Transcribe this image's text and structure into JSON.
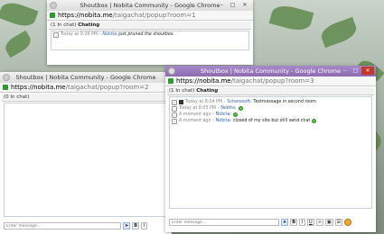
{
  "windows": {
    "back": {
      "title": "Shoutbox | Nobita Community - Google Chrome",
      "url_host": "https://nobita.me",
      "url_path": "/taigachat/popup?room=1",
      "chat_count": "(1 In chat)",
      "chat_status": "Chating",
      "messages": [
        {
          "time": "Today at 9:26 PM -",
          "user": "Nobita",
          "text": "just pruned the shoutbox."
        }
      ]
    },
    "middle": {
      "title": "Shoutbox | Nobita Community - Google Chrome",
      "url_host": "https://nobita.me",
      "url_path": "/taigachat/popup?room=2",
      "chat_count": "(0 In chat)",
      "input_placeholder": "Enter message..."
    },
    "front": {
      "title": "Shoutbox | Nobita Community - Google Chrome",
      "url_host": "https://nobita.me",
      "url_path": "/taigachat/popup?room=3",
      "chat_count": "(1 In chat)",
      "chat_status": "Chating",
      "messages": [
        {
          "time": "Today at 8:04 PM -",
          "user": "Scharesoft:",
          "text": "Testmessage in second room",
          "avatar": true,
          "emote": false
        },
        {
          "time": "Today at 8:05 PM -",
          "user": "Nobita:",
          "text": "",
          "avatar": false,
          "emote": true
        },
        {
          "time": "A moment ago -",
          "user": "Nobita:",
          "text": "",
          "avatar": false,
          "emote": true
        },
        {
          "time": "A moment ago -",
          "user": "Nobita:",
          "text": "closed of my site but still send chat",
          "avatar": false,
          "emote": true
        }
      ],
      "input_placeholder": "Enter message..."
    }
  },
  "colors": {
    "accent_title": "#9a7cc0",
    "link": "#3a66b0",
    "secure_lock": "#2e9b2e"
  },
  "toolbar": {
    "bold": "B",
    "italic": "I",
    "underline": "U"
  }
}
